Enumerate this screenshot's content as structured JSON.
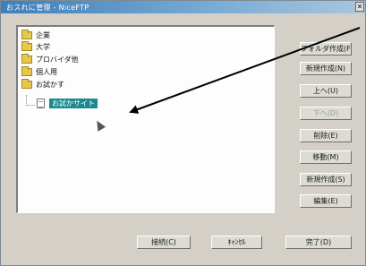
{
  "window": {
    "title": "おスれに管理 - NiceFTP"
  },
  "tree": {
    "items": [
      {
        "label": "企業"
      },
      {
        "label": "大学"
      },
      {
        "label": "プロバイダ他"
      },
      {
        "label": "個人用"
      },
      {
        "label": "お試かす"
      }
    ],
    "selected": "お試かサイト"
  },
  "side_buttons": [
    {
      "label": "フォルダ作成(F)",
      "enabled": true
    },
    {
      "label": "新規作成(N)",
      "enabled": true
    },
    {
      "label": "上へ(U)",
      "enabled": true
    },
    {
      "label": "下へ(D)",
      "enabled": false
    },
    {
      "label": "削除(E)",
      "enabled": true
    },
    {
      "label": "移動(M)",
      "enabled": true
    },
    {
      "label": "新規作成(S)",
      "enabled": true
    },
    {
      "label": "編集(E)",
      "enabled": true
    }
  ],
  "bottom_buttons": {
    "connect": "接続(C)",
    "cancel": "ｷｬﾝｾﾙ",
    "done": "完了(D)"
  }
}
